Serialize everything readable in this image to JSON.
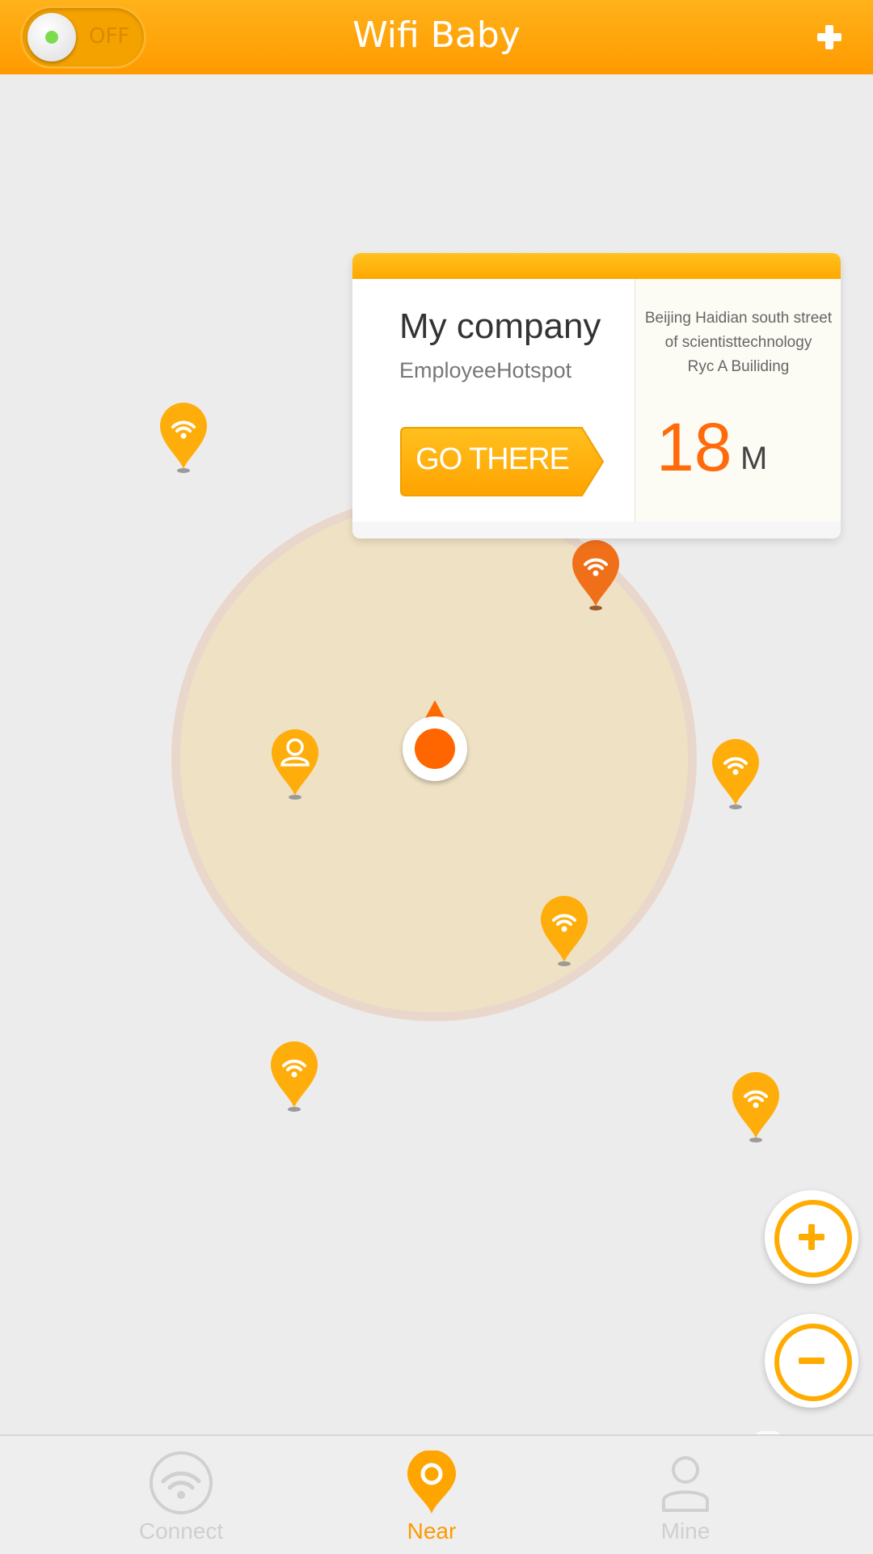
{
  "app": {
    "title": "Wifi Baby",
    "toggle_label": "OFF",
    "accent_color": "#ff9d00",
    "add_icon": "plus-icon"
  },
  "map": {
    "hotspot_icon": "wifi-pin-icon",
    "user_pin_icon": "user-pin-icon",
    "current_location_icon": "location-dot-icon"
  },
  "card": {
    "title": "My company",
    "subtitle": "EmployeeHotspot",
    "button_label": "GO THERE",
    "address_lines": [
      "Beijing Haidian south street",
      "of scientisttechnology",
      "Ryc A Builiding"
    ],
    "distance_value": "18",
    "distance_unit": "M"
  },
  "zoom": {
    "in_icon": "zoom-in-icon",
    "out_icon": "zoom-out-icon"
  },
  "nav": {
    "items": [
      {
        "label": "Connect",
        "icon": "wifi-icon",
        "active": false
      },
      {
        "label": "Near",
        "icon": "location-pin-icon",
        "active": true
      },
      {
        "label": "Mine",
        "icon": "person-icon",
        "active": false
      }
    ],
    "active_color": "#ff9d00",
    "inactive_color": "#cfcfcf"
  }
}
